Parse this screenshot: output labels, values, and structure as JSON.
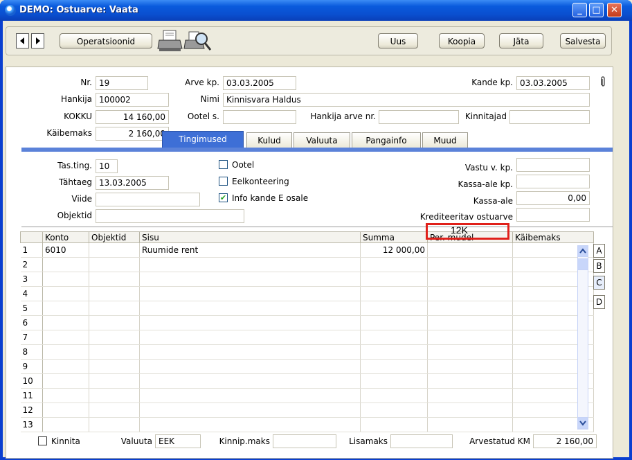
{
  "window": {
    "title": "DEMO: Ostuarve: Vaata"
  },
  "toolbar": {
    "operations_label": "Operatsioonid",
    "new_label": "Uus",
    "copy_label": "Koopia",
    "skip_label": "Jäta",
    "save_label": "Salvesta",
    "print_icon": "printer-icon",
    "preview_icon": "print-preview-icon"
  },
  "header": {
    "nr_label": "Nr.",
    "nr_value": "19",
    "invoice_date_label": "Arve kp.",
    "invoice_date_value": "03.03.2005",
    "entry_date_label": "Kande kp.",
    "entry_date_value": "03.03.2005",
    "supplier_label": "Hankija",
    "supplier_value": "100002",
    "name_label": "Nimi",
    "name_value": "Kinnisvara Haldus",
    "total_label": "KOKKU",
    "total_value": "14 160,00",
    "waiting_label": "Ootel s.",
    "waiting_value": "",
    "supplier_inv_label": "Hankija arve nr.",
    "supplier_inv_value": "",
    "approvers_label": "Kinnitajad",
    "approvers_value": "",
    "vat_label": "Käibemaks",
    "vat_value": "2 160,00"
  },
  "tabs": [
    "Tingimused",
    "Kulud",
    "Valuuta",
    "Pangainfo",
    "Muud"
  ],
  "terms": {
    "pay_terms_label": "Tas.ting.",
    "pay_terms_value": "10",
    "due_label": "Tähtaeg",
    "due_value": "13.03.2005",
    "ref_label": "Viide",
    "ref_value": "",
    "objects_label": "Objektid",
    "objects_value": "",
    "ootel_label": "Ootel",
    "preaccount_label": "Eelkonteering",
    "info_label": "Info kande E osale",
    "recv_date_label": "Vastu v. kp.",
    "recv_date_value": "",
    "disc_date_label": "Kassa-ale kp.",
    "disc_date_value": "",
    "disc_label": "Kassa-ale",
    "disc_value": "0,00",
    "credited_label": "Krediteeritav ostuarve",
    "credited_value": ""
  },
  "grid": {
    "columns": [
      "Konto",
      "Objektid",
      "Sisu",
      "Summa",
      "Per. mudel",
      "Käibemaks"
    ],
    "rows": [
      {
        "n": "1",
        "konto": "6010",
        "objektid": "",
        "sisu": "Ruumide rent",
        "summa": "12 000,00",
        "per": "12K",
        "kaibemaks": ""
      },
      {
        "n": "2"
      },
      {
        "n": "3"
      },
      {
        "n": "4"
      },
      {
        "n": "5"
      },
      {
        "n": "6"
      },
      {
        "n": "7"
      },
      {
        "n": "8"
      },
      {
        "n": "9"
      },
      {
        "n": "10"
      },
      {
        "n": "11"
      },
      {
        "n": "12"
      },
      {
        "n": "13"
      }
    ],
    "side_buttons": [
      "A",
      "B",
      "C",
      "D"
    ]
  },
  "footer": {
    "approve_label": "Kinnita",
    "currency_label": "Valuuta",
    "currency_value": "EEK",
    "fixed_rate_label": "Kinnip.maks",
    "fixed_rate_value": "",
    "extra_tax_label": "Lisamaks",
    "extra_tax_value": "",
    "calc_vat_label": "Arvestatud KM",
    "calc_vat_value": "2 160,00"
  }
}
